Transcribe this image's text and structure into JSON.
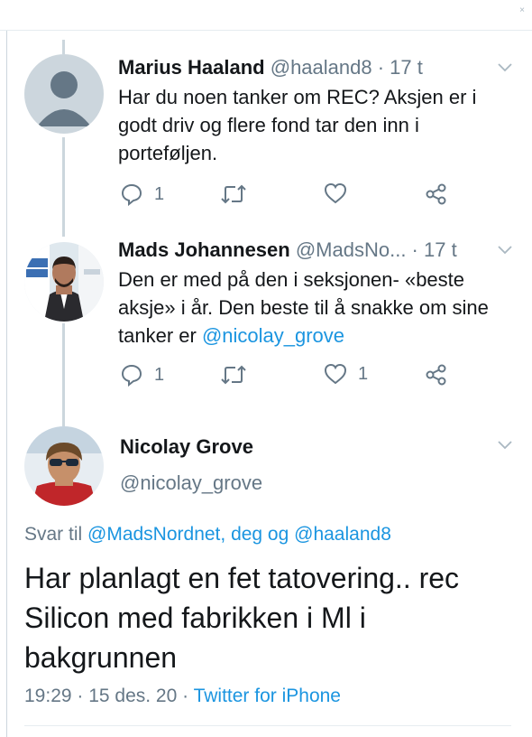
{
  "tweets": [
    {
      "name": "Marius Haaland",
      "handle": "@haaland8",
      "sep": " · ",
      "time": "17 t",
      "text": "Har du noen tanker om REC? Aksjen er i godt driv og flere fond tar den inn i porteføljen.",
      "reply_count": "1",
      "like_count": "",
      "avatar": "default-avatar"
    },
    {
      "name": "Mads Johannesen",
      "handle": "@MadsNo...",
      "sep": " · ",
      "time": "17 t",
      "text_before": "Den er med på den i seksjonen- «beste aksje» i år. Den beste til å snakke om sine tanker er ",
      "mention": "@nicolay_grove",
      "reply_count": "1",
      "like_count": "1",
      "avatar": "photo-avatar"
    }
  ],
  "main_tweet": {
    "name": "Nicolay Grove",
    "handle": "@nicolay_grove",
    "reply_prefix": "Svar til ",
    "reply_mentions": "@MadsNordnet, deg og @haaland8",
    "text": "Har planlagt en fet tatovering.. rec Silicon med fabrikken i Ml i bakgrunnen",
    "timestamp": "19:29 · 15 des. 20 · ",
    "source": "Twitter for iPhone"
  },
  "colors": {
    "link": "#1b95e0",
    "secondary_text": "#657786",
    "thread_line": "#ccd6dd"
  },
  "icons": [
    "reply-icon",
    "retweet-icon",
    "like-icon",
    "share-icon",
    "chevron-down-icon",
    "close-icon"
  ],
  "window": {
    "close_glyph": "×"
  }
}
